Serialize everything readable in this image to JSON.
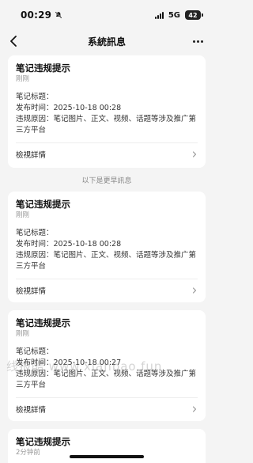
{
  "status_bar": {
    "time": "00:29",
    "network": "5G",
    "battery": "42"
  },
  "nav": {
    "title": "系統訊息"
  },
  "separator": {
    "text": "以下是更早訊息"
  },
  "cards": [
    {
      "title": "笔记违规提示",
      "time": "刚刚",
      "line1": "笔记标题：",
      "line2": "发布时间：2025-10-18 00:28",
      "line3": "违规原因：笔记图片、正文、视频、话题等涉及推广第",
      "line4": "三方平台",
      "action": "檢視詳情"
    },
    {
      "title": "笔记违规提示",
      "time": "刚刚",
      "line1": "笔记标题：",
      "line2": "发布时间：2025-10-18 00:28",
      "line3": "违规原因：笔记图片、正文、视频、话题等涉及推广第",
      "line4": "三方平台",
      "action": "檢視詳情"
    },
    {
      "title": "笔记违规提示",
      "time": "刚刚",
      "line1": "笔记标题：",
      "line2": "发布时间：2025-10-18 00:27",
      "line3": "违规原因：笔记图片、正文、视频、话题等涉及推广第",
      "line4": "三方平台",
      "action": "檢視詳情"
    },
    {
      "title": "笔记违规提示",
      "time": "2分钟前"
    }
  ],
  "watermark": "线报酷 www.xianbao.fun"
}
